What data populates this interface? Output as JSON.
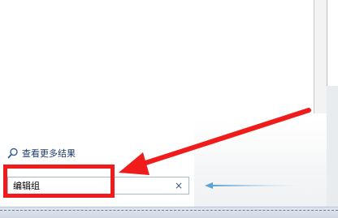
{
  "start_menu": {
    "see_more_results": "查看更多结果",
    "see_more_icon": "search-icon",
    "search_box": {
      "value": "编辑组",
      "clear_icon": "close-icon",
      "clear_glyph": "×"
    }
  },
  "annotation": {
    "highlight_color": "#f01c1c",
    "arrow_color": "#f01c1c",
    "hint_arrow_color": "#7fb8e0"
  }
}
